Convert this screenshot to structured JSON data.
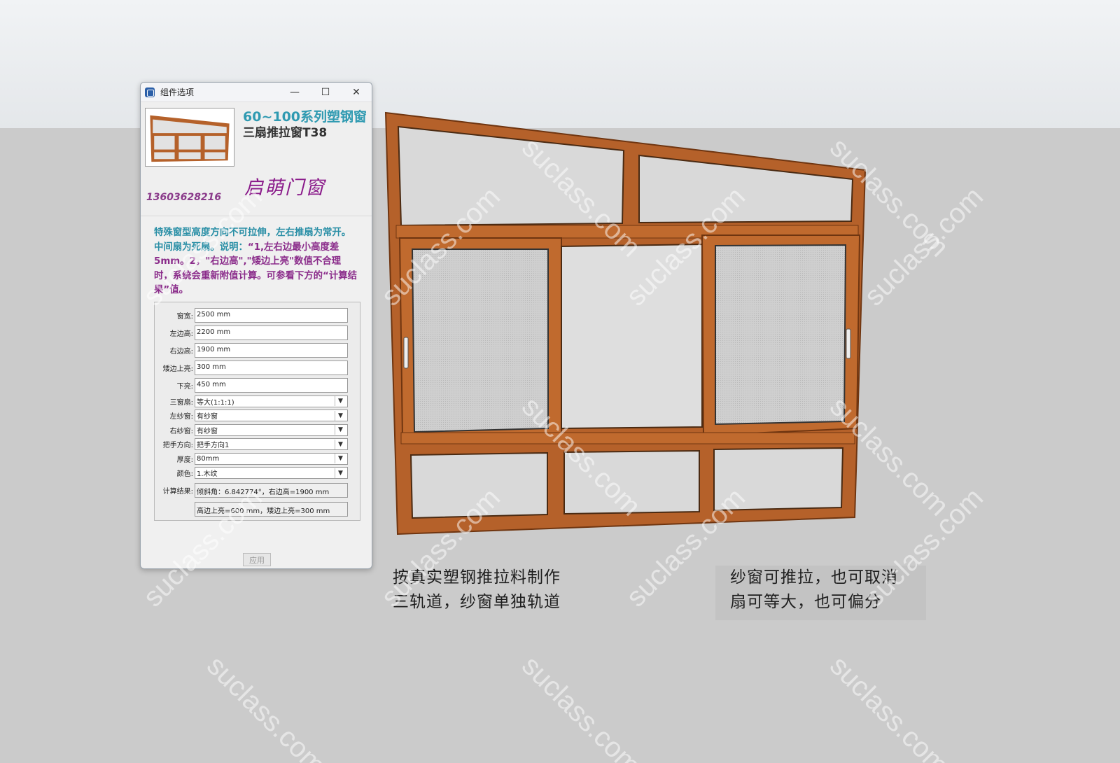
{
  "dialog": {
    "title": "组件选项",
    "window_controls": {
      "minimize": "—",
      "maximize": "☐",
      "close": "✕"
    },
    "header": {
      "title1": "60~100系列塑钢窗",
      "title2": "三扇推拉窗T38",
      "brand": "启萌门窗",
      "phone": "13603628216"
    },
    "description": {
      "teal_part": "特殊窗型高度方向不可拉伸，左右推扇为常开。中间扇为死扇。说明：",
      "purple_part": "“1,左右边最小高度差5mm。2，\"右边高\",\"矮边上亮\"数值不合理时，系统会重新附值计算。可参看下方的“计算结果”值。"
    },
    "fields": [
      {
        "label": "窗宽:",
        "value": "2500 mm"
      },
      {
        "label": "左边高:",
        "value": "2200 mm"
      },
      {
        "label": "右边高:",
        "value": "1900 mm"
      },
      {
        "label": "矮边上亮:",
        "value": "300 mm"
      },
      {
        "label": "下亮:",
        "value": "450 mm"
      }
    ],
    "selects": [
      {
        "label": "三窗扇:",
        "value": "等大(1:1:1)"
      },
      {
        "label": "左纱窗:",
        "value": "有纱窗"
      },
      {
        "label": "右纱窗:",
        "value": "有纱窗"
      },
      {
        "label": "把手方向:",
        "value": "把手方向1"
      },
      {
        "label": "厚度:",
        "value": "80mm"
      },
      {
        "label": "颜色:",
        "value": "1.木纹"
      }
    ],
    "results": {
      "label": "计算结果:",
      "line1": "倾斜角：6.842774°，右边高=1900 mm",
      "line2": "高边上亮=600 mm，矮边上亮=300 mm"
    },
    "apply_label": "应用"
  },
  "captions": {
    "left_line1": "按真实塑钢推拉料制作",
    "left_line2": "三轨道，纱窗单独轨道",
    "right_line1": "纱窗可推拉，也可取消",
    "right_line2": "扇可等大，也可偏分"
  },
  "watermark": "suclass.com",
  "colors": {
    "frame": "#b5612a",
    "frame_dark": "#7a3c14",
    "glass": "#d9d9d9",
    "screen_mesh": "#c8c8c8",
    "title_teal": "#2f9ab1",
    "brand_purple": "#8a1a8a"
  }
}
